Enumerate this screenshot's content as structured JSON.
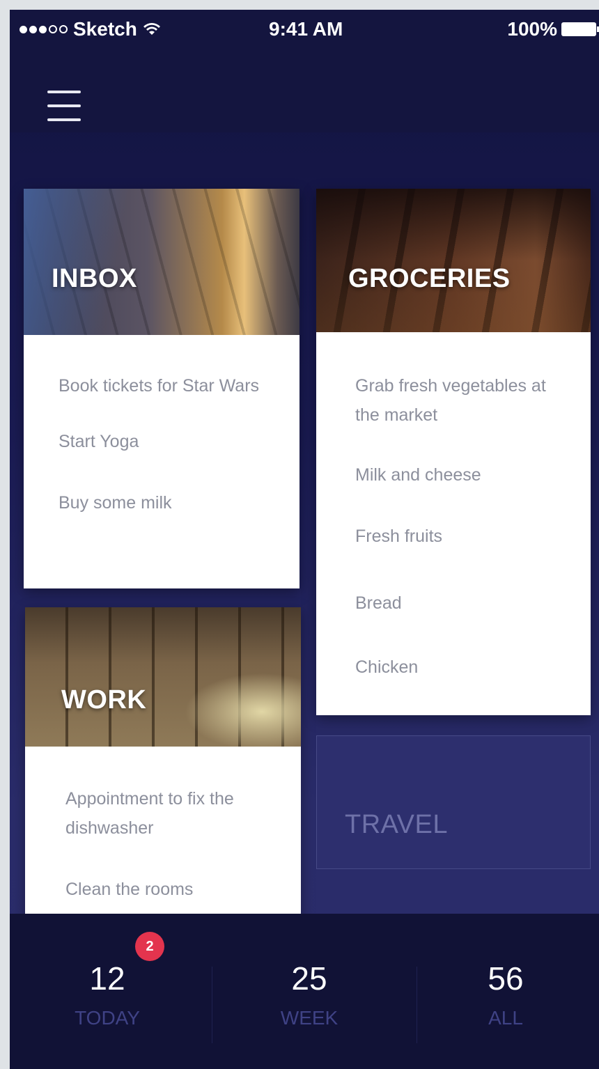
{
  "status_bar": {
    "carrier": "Sketch",
    "time": "9:41 AM",
    "battery": "100%"
  },
  "header": {
    "menu_icon": "hamburger-menu-icon"
  },
  "cards": {
    "inbox": {
      "title": "INBOX",
      "items": [
        "Book tickets for Star Wars",
        "Start Yoga",
        "Buy some milk"
      ]
    },
    "groceries": {
      "title": "GROCERIES",
      "items": [
        "Grab fresh vegetables at the market",
        "Milk and cheese",
        "Fresh fruits",
        "Bread",
        "Chicken"
      ]
    },
    "work": {
      "title": "WORK",
      "items": [
        "Appointment to fix the dishwasher",
        "Clean the rooms"
      ]
    },
    "travel": {
      "title": "TRAVEL"
    }
  },
  "stats": {
    "today": {
      "value": "12",
      "label": "TODAY",
      "badge": "2"
    },
    "week": {
      "value": "25",
      "label": "WEEK"
    },
    "all": {
      "value": "56",
      "label": "ALL"
    }
  },
  "colors": {
    "background": "#14153f",
    "badge": "#e3344e",
    "stat_label": "#3f4285",
    "list_text": "#8c8f9c"
  }
}
